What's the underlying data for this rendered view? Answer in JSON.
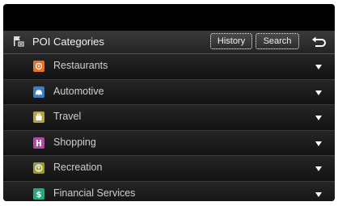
{
  "header": {
    "title": "POI Categories",
    "icon": "poi-flag-icon",
    "history_label": "History",
    "search_label": "Search",
    "back_icon": "back-arrow-icon"
  },
  "categories": [
    {
      "label": "Restaurants",
      "icon": "restaurant-icon",
      "color": "#e8742a"
    },
    {
      "label": "Automotive",
      "icon": "car-icon",
      "color": "#3a7fc4"
    },
    {
      "label": "Travel",
      "icon": "luggage-icon",
      "color": "#b5a34a"
    },
    {
      "label": "Shopping",
      "icon": "shopping-icon",
      "color": "#b04aa6"
    },
    {
      "label": "Recreation",
      "icon": "recreation-icon",
      "color": "#9a9a3a"
    },
    {
      "label": "Financial Services",
      "icon": "dollar-icon",
      "color": "#2aa87a"
    }
  ]
}
